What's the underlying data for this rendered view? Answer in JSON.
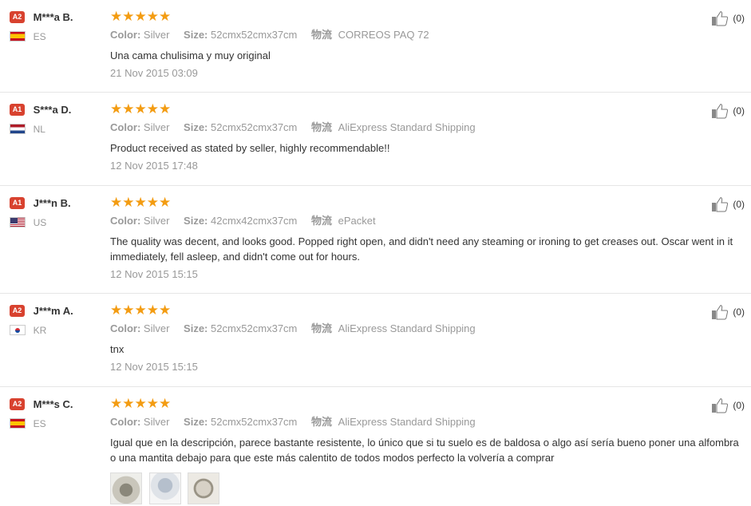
{
  "labels": {
    "color": "Color:",
    "size": "Size:",
    "logistics_icon": "物流"
  },
  "reviews": [
    {
      "level": "A2",
      "name": "M***a B.",
      "country": "ES",
      "stars": "★★★★★",
      "color": "Silver",
      "size": "52cmx52cmx37cm",
      "shipping": "CORREOS PAQ 72",
      "text": "Una cama chulisima y muy original",
      "date": "21 Nov 2015 03:09",
      "helpful": "(0)"
    },
    {
      "level": "A1",
      "name": "S***a D.",
      "country": "NL",
      "stars": "★★★★★",
      "color": "Silver",
      "size": "52cmx52cmx37cm",
      "shipping": "AliExpress Standard Shipping",
      "text": "Product received as stated by seller, highly recommendable!!",
      "date": "12 Nov 2015 17:48",
      "helpful": "(0)"
    },
    {
      "level": "A1",
      "name": "J***n B.",
      "country": "US",
      "stars": "★★★★★",
      "color": "Silver",
      "size": "42cmx42cmx37cm",
      "shipping": "ePacket",
      "text": "The quality was decent, and looks good. Popped right open, and didn't need any steaming or ironing to get creases out. Oscar went in it immediately, fell asleep, and didn't come out for hours.",
      "date": "12 Nov 2015 15:15",
      "helpful": "(0)"
    },
    {
      "level": "A2",
      "name": "J***m A.",
      "country": "KR",
      "stars": "★★★★★",
      "color": "Silver",
      "size": "52cmx52cmx37cm",
      "shipping": "AliExpress Standard Shipping",
      "text": "tnx",
      "date": "12 Nov 2015 15:15",
      "helpful": "(0)"
    },
    {
      "level": "A2",
      "name": "M***s C.",
      "country": "ES",
      "stars": "★★★★★",
      "color": "Silver",
      "size": "52cmx52cmx37cm",
      "shipping": "AliExpress Standard Shipping",
      "text": "Igual que en la descripción, parece bastante resistente, lo único que si tu suelo es de baldosa o algo así sería bueno poner una alfombra o una mantita debajo para que este más calentito de todos modos perfecto la volvería a comprar",
      "date": "",
      "helpful": "(0)"
    }
  ]
}
